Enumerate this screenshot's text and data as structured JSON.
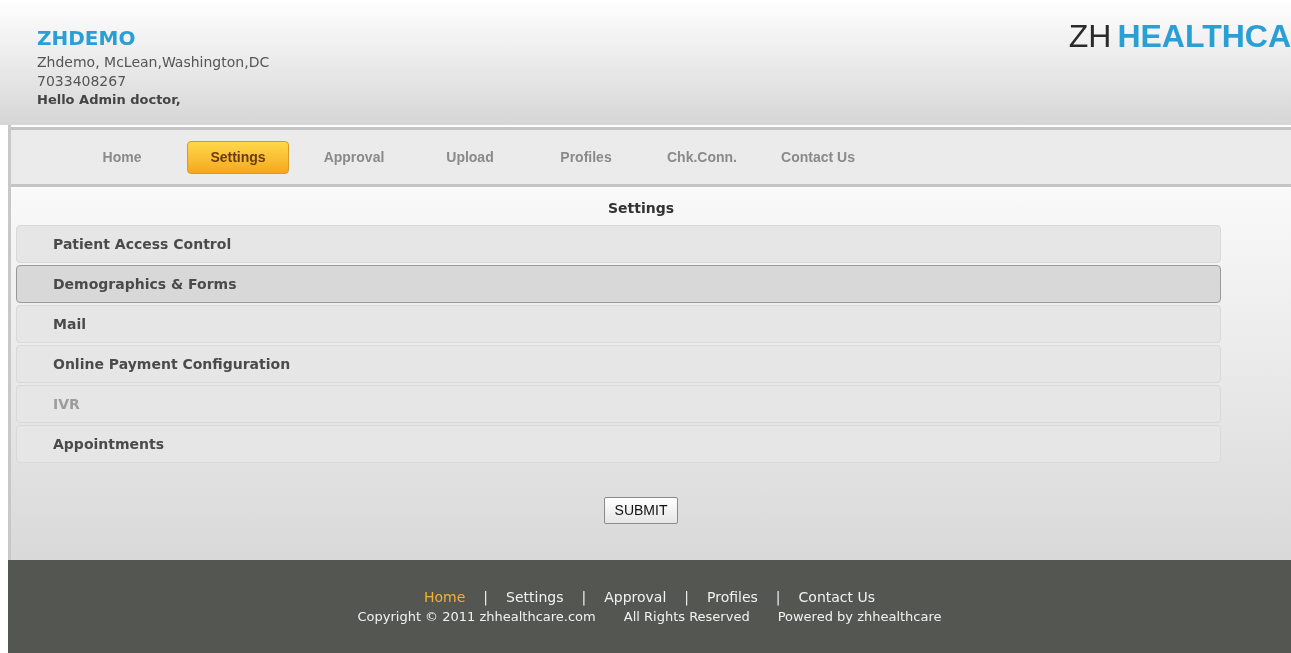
{
  "header": {
    "clinic_name": "ZHDEMO",
    "address": "Zhdemo, McLean,Washington,DC",
    "phone": "7033408267",
    "greeting": "Hello Admin doctor,",
    "logo": {
      "prefix": "ZH",
      "name": "HEALTHCA"
    }
  },
  "nav": [
    {
      "label": "Home",
      "selected": false
    },
    {
      "label": "Settings",
      "selected": true
    },
    {
      "label": "Approval",
      "selected": false
    },
    {
      "label": "Upload",
      "selected": false
    },
    {
      "label": "Profiles",
      "selected": false
    },
    {
      "label": "Chk.Conn.",
      "selected": false
    },
    {
      "label": "Contact Us",
      "selected": false
    }
  ],
  "page_title": "Settings",
  "sections": [
    {
      "label": "Patient Access Control",
      "selected": false,
      "disabled": false
    },
    {
      "label": "Demographics & Forms",
      "selected": true,
      "disabled": false
    },
    {
      "label": "Mail",
      "selected": false,
      "disabled": false
    },
    {
      "label": "Online Payment Configuration",
      "selected": false,
      "disabled": false
    },
    {
      "label": "IVR",
      "selected": false,
      "disabled": true
    },
    {
      "label": "Appointments",
      "selected": false,
      "disabled": false
    }
  ],
  "submit_button": "SUBMIT",
  "footer": {
    "separator": "|",
    "links": [
      {
        "label": "Home",
        "selected": true
      },
      {
        "label": "Settings",
        "selected": false
      },
      {
        "label": "Approval",
        "selected": false
      },
      {
        "label": "Profiles",
        "selected": false
      },
      {
        "label": "Contact Us",
        "selected": false
      }
    ],
    "copyright": "Copyright © 2011 zhhealthcare.com",
    "rights": "All Rights Reserved",
    "powered": "Powered by zhhealthcare"
  }
}
